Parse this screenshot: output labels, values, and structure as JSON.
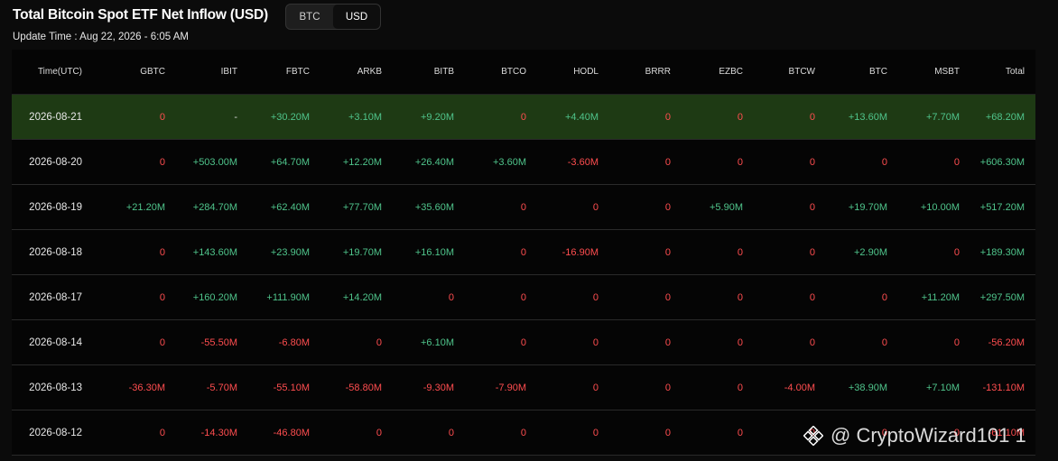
{
  "title": "Total Bitcoin Spot ETF Net Inflow (USD)",
  "toggle": {
    "options": [
      "BTC",
      "USD"
    ],
    "active": "USD"
  },
  "update_time": "Update Time : Aug 22, 2026 - 6:05 AM",
  "columns": [
    "Time(UTC)",
    "GBTC",
    "IBIT",
    "FBTC",
    "ARKB",
    "BITB",
    "BTCO",
    "HODL",
    "BRRR",
    "EZBC",
    "BTCW",
    "BTC",
    "MSBT",
    "Total"
  ],
  "rows": [
    {
      "highlight": true,
      "cells": [
        "2026-08-21",
        "0",
        "-",
        "+30.20M",
        "+3.10M",
        "+9.20M",
        "0",
        "+4.40M",
        "0",
        "0",
        "0",
        "+13.60M",
        "+7.70M",
        "+68.20M"
      ]
    },
    {
      "highlight": false,
      "cells": [
        "2026-08-20",
        "0",
        "+503.00M",
        "+64.70M",
        "+12.20M",
        "+26.40M",
        "+3.60M",
        "-3.60M",
        "0",
        "0",
        "0",
        "0",
        "0",
        "+606.30M"
      ]
    },
    {
      "highlight": false,
      "cells": [
        "2026-08-19",
        "+21.20M",
        "+284.70M",
        "+62.40M",
        "+77.70M",
        "+35.60M",
        "0",
        "0",
        "0",
        "+5.90M",
        "0",
        "+19.70M",
        "+10.00M",
        "+517.20M"
      ]
    },
    {
      "highlight": false,
      "cells": [
        "2026-08-18",
        "0",
        "+143.60M",
        "+23.90M",
        "+19.70M",
        "+16.10M",
        "0",
        "-16.90M",
        "0",
        "0",
        "0",
        "+2.90M",
        "0",
        "+189.30M"
      ]
    },
    {
      "highlight": false,
      "cells": [
        "2026-08-17",
        "0",
        "+160.20M",
        "+111.90M",
        "+14.20M",
        "0",
        "0",
        "0",
        "0",
        "0",
        "0",
        "0",
        "+11.20M",
        "+297.50M"
      ]
    },
    {
      "highlight": false,
      "cells": [
        "2026-08-14",
        "0",
        "-55.50M",
        "-6.80M",
        "0",
        "+6.10M",
        "0",
        "0",
        "0",
        "0",
        "0",
        "0",
        "0",
        "-56.20M"
      ]
    },
    {
      "highlight": false,
      "cells": [
        "2026-08-13",
        "-36.30M",
        "-5.70M",
        "-55.10M",
        "-58.80M",
        "-9.30M",
        "-7.90M",
        "0",
        "0",
        "0",
        "-4.00M",
        "+38.90M",
        "+7.10M",
        "-131.10M"
      ]
    },
    {
      "highlight": false,
      "cells": [
        "2026-08-12",
        "0",
        "-14.30M",
        "-46.80M",
        "0",
        "0",
        "0",
        "0",
        "0",
        "0",
        "0",
        "0",
        "0",
        "-61.10M"
      ]
    }
  ],
  "watermark": "@ CryptoWizard101 1",
  "colors": {
    "positive": "#4fc48b",
    "negative": "#ff4d4f",
    "highlight_row": "#1e3a14",
    "background": "#0b0b0b"
  }
}
